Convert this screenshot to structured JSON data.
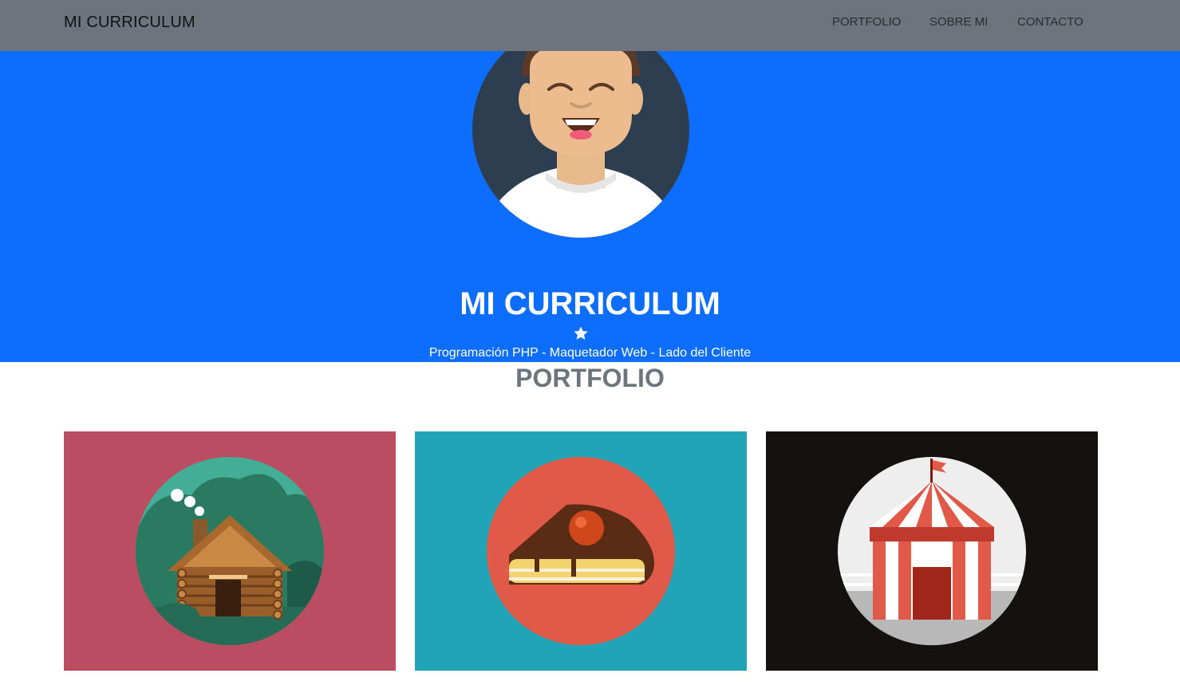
{
  "navbar": {
    "brand": "MI CURRICULUM",
    "links": [
      "PORTFOLIO",
      "SOBRE MI",
      "CONTACTO"
    ]
  },
  "hero": {
    "title": "MI CURRICULUM",
    "subtitle": "Programación PHP - Maquetador Web - Lado del Cliente"
  },
  "portfolio": {
    "title": "PORTFOLIO",
    "items": [
      {
        "subject": "cabin",
        "bg": "#bb4d62"
      },
      {
        "subject": "cake",
        "bg": "#20a4b6"
      },
      {
        "subject": "circus-tent",
        "bg": "#141110"
      }
    ]
  },
  "colors": {
    "navbar": "#6c757d",
    "hero": "#0d6efd",
    "title_gray": "#6c757d"
  }
}
